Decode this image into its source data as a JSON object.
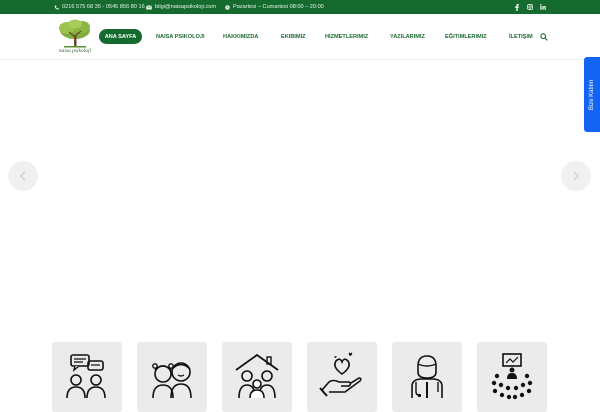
{
  "topbar": {
    "phone": "0216 575 68 35 - 0545 856 80 16",
    "email": "bilgi@naisapsikoloji.com",
    "hours": "Pazartesi – Cumartesi 08:00 – 20:00",
    "social": [
      "f",
      "ig",
      "in"
    ]
  },
  "logo": {
    "text": "naisa psikoloji"
  },
  "nav": {
    "items": [
      "ANA SAYFA",
      "NAISA PSIKOLOJI",
      "HAKKIMIZDA",
      "EKIBIMIZ",
      "HIZMETLERIMIZ",
      "YAZILARIMIZ",
      "EĞITIMLERIMIZ",
      "İLETIŞIM"
    ],
    "active": "ANA SAYFA"
  },
  "side_tab": {
    "label": "Bize Katılın"
  },
  "colors": {
    "brand_green": "#156b2e",
    "accent_blue": "#1464f4",
    "card_bg": "#ebebeb"
  },
  "cards": [
    {
      "icon": "counseling-chat-icon"
    },
    {
      "icon": "children-icon"
    },
    {
      "icon": "family-home-icon"
    },
    {
      "icon": "heart-hand-icon"
    },
    {
      "icon": "psychologist-icon"
    },
    {
      "icon": "seminar-audience-icon"
    }
  ]
}
